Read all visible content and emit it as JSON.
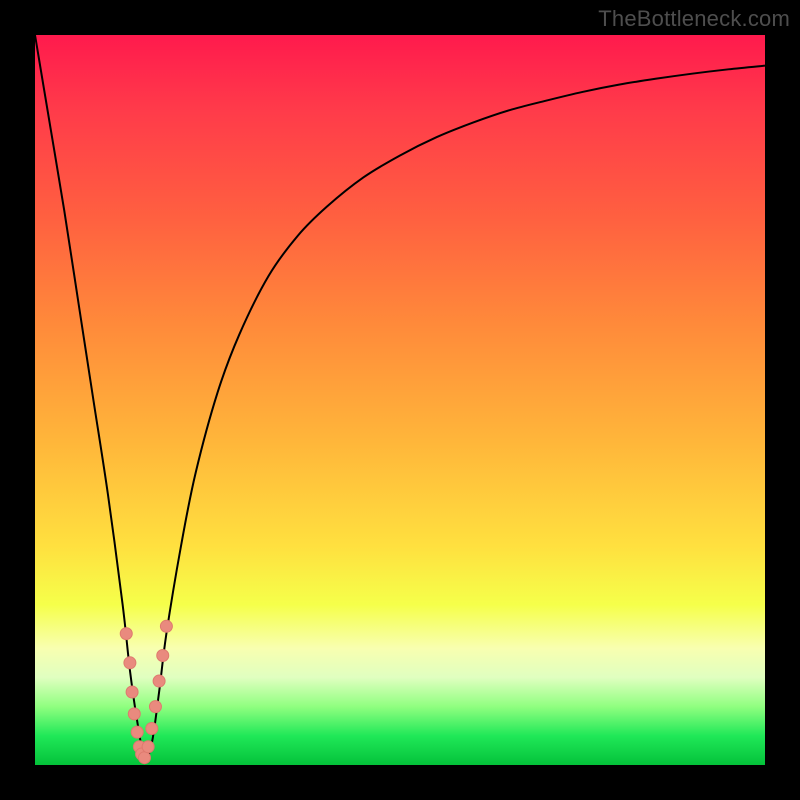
{
  "watermark": "TheBottleneck.com",
  "colors": {
    "frame_bg": "#000000",
    "curve_stroke": "#000000",
    "marker_fill": "#e98a7e",
    "marker_stroke": "#de7a6e"
  },
  "chart_data": {
    "type": "line",
    "title": "",
    "xlabel": "",
    "ylabel": "",
    "xlim": [
      0,
      100
    ],
    "ylim": [
      0,
      100
    ],
    "grid": false,
    "legend": false,
    "series": [
      {
        "name": "bottleneck-curve",
        "x": [
          0,
          2,
          4,
          6,
          8,
          10,
          12,
          13,
          14,
          15,
          16,
          17,
          18,
          20,
          22,
          25,
          28,
          32,
          36,
          40,
          45,
          50,
          55,
          60,
          65,
          70,
          75,
          80,
          85,
          90,
          95,
          100
        ],
        "y": [
          100,
          88,
          76,
          63,
          50,
          37,
          22,
          13,
          6,
          1,
          3,
          10,
          18,
          30,
          40,
          51,
          59,
          67,
          72.5,
          76.5,
          80.5,
          83.5,
          86,
          88,
          89.7,
          91,
          92.2,
          93.2,
          94,
          94.7,
          95.3,
          95.8
        ]
      }
    ],
    "markers": {
      "name": "data-points",
      "x": [
        12.5,
        13.0,
        13.3,
        13.6,
        14.0,
        14.3,
        14.6,
        15.0,
        15.5,
        16.0,
        16.5,
        17.0,
        17.5,
        18.0
      ],
      "y": [
        18.0,
        14.0,
        10.0,
        7.0,
        4.5,
        2.5,
        1.5,
        1.0,
        2.5,
        5.0,
        8.0,
        11.5,
        15.0,
        19.0
      ],
      "r": 6
    }
  }
}
